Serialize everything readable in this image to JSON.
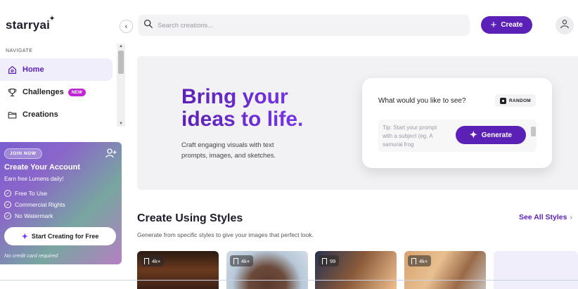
{
  "app": {
    "logo": "starryai"
  },
  "sidebar": {
    "nav_heading": "NAVIGATE",
    "items": [
      {
        "label": "Home",
        "icon": "home-icon",
        "active": true
      },
      {
        "label": "Challenges",
        "icon": "trophy-icon",
        "badge": "NEW"
      },
      {
        "label": "Creations",
        "icon": "folder-icon"
      }
    ],
    "promo": {
      "pill": "JOIN NOW",
      "title": "Create Your Account",
      "subtitle": "Earn free Lumens daily!",
      "perks": [
        "Free To Use",
        "Commercial Rights",
        "No Watermark"
      ],
      "cta": "Start Creating for Free",
      "note": "No credit card required"
    }
  },
  "topbar": {
    "search_placeholder": "Search creations...",
    "create_label": "Create"
  },
  "hero": {
    "title": "Bring your ideas to life.",
    "description": "Craft engaging visuals with text prompts, images, and sketches.",
    "prompt_question": "What would you like to see?",
    "random_label": "RANDOM",
    "prompt_placeholder": "Tip: Start your prompt with a subject (eg. A samurai frog",
    "generate_label": "Generate"
  },
  "styles": {
    "title": "Create Using Styles",
    "subtitle": "Generate from specific styles to give your images that perfect look.",
    "see_all": "See All Styles",
    "cards": [
      {
        "count": "4k+"
      },
      {
        "count": "4k+"
      },
      {
        "count": "99"
      },
      {
        "count": "4k+"
      }
    ]
  },
  "colors": {
    "accent": "#5b21b6",
    "badge": "#c026d3"
  }
}
